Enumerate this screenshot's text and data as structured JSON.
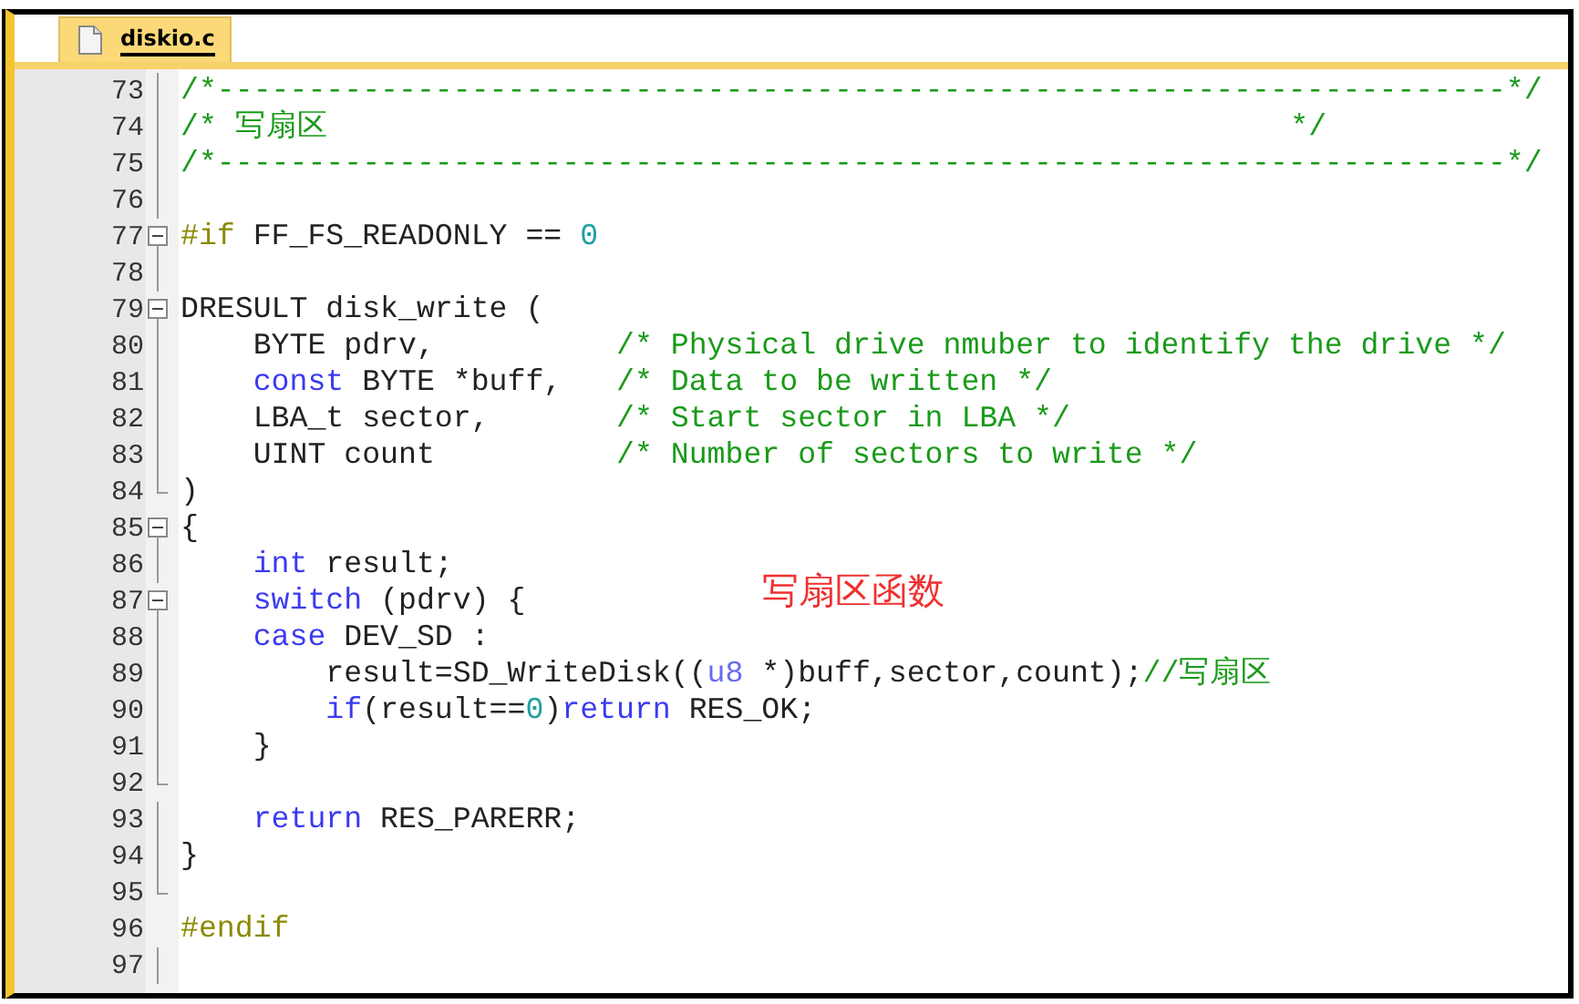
{
  "tabs": [
    {
      "label": "diskio.c",
      "selected": true
    }
  ],
  "lines": [
    {
      "number": "73",
      "kind": "body",
      "tokens": [
        {
          "text": "/*-----------------------------------------------------------------------*/",
          "kind": "comment"
        }
      ]
    },
    {
      "number": "74",
      "kind": "body",
      "tokens": [
        {
          "text": "/* 写扇区                                                     */",
          "kind": "comment"
        }
      ]
    },
    {
      "number": "75",
      "kind": "body",
      "tokens": [
        {
          "text": "/*-----------------------------------------------------------------------*/",
          "kind": "comment"
        }
      ]
    },
    {
      "number": "76",
      "kind": "body"
    },
    {
      "number": "77",
      "kind": "start",
      "tokens": [
        {
          "text": "#if",
          "kind": "pre"
        },
        {
          "text": " FF_FS_READONLY == ",
          "kind": "plain"
        },
        {
          "text": "0",
          "kind": "number"
        }
      ]
    },
    {
      "number": "78",
      "kind": "body"
    },
    {
      "number": "79",
      "kind": "start",
      "tokens": [
        {
          "text": "DRESULT disk_write (",
          "kind": "plain"
        }
      ],
      "children": [
        {
          "number": "80",
          "kind": "body",
          "tokens": [
            {
              "text": "BYTE pdrv,          ",
              "kind": "plain"
            },
            {
              "text": "/* Physical drive nmuber to identify the drive */",
              "kind": "comment"
            }
          ]
        },
        {
          "number": "81",
          "kind": "body",
          "tokens": [
            {
              "text": "const",
              "kind": "keyword"
            },
            {
              "text": " BYTE *buff,   ",
              "kind": "plain"
            },
            {
              "text": "/* Data to be written */",
              "kind": "comment"
            }
          ]
        },
        {
          "number": "82",
          "kind": "body",
          "tokens": [
            {
              "text": "LBA_t sector,       ",
              "kind": "plain"
            },
            {
              "text": "/* Start sector in LBA */",
              "kind": "comment"
            }
          ]
        },
        {
          "number": "83",
          "kind": "body",
          "tokens": [
            {
              "text": "UINT count          ",
              "kind": "plain"
            },
            {
              "text": "/* Number of sectors to write */",
              "kind": "comment"
            }
          ]
        }
      ]
    },
    {
      "number": "84",
      "kind": "end",
      "tokens": [
        {
          "text": ")",
          "kind": "plain"
        }
      ]
    },
    {
      "number": "85",
      "kind": "start",
      "tokens": [
        {
          "text": "{",
          "kind": "plain"
        }
      ],
      "children": [
        {
          "number": "86",
          "kind": "body",
          "tokens": [
            {
              "text": "int",
              "kind": "keyword"
            },
            {
              "text": " result;",
              "kind": "plain"
            }
          ]
        },
        {
          "number": "87",
          "kind": "start",
          "tokens": [
            {
              "text": "switch",
              "kind": "keyword"
            },
            {
              "text": " (pdrv) {",
              "kind": "plain"
            }
          ]
        },
        {
          "number": "88",
          "kind": "body",
          "tokens": [
            {
              "text": "case",
              "kind": "keyword"
            },
            {
              "text": " DEV_SD :",
              "kind": "plain"
            }
          ],
          "children": [
            {
              "number": "89",
              "kind": "body",
              "tokens": [
                {
                  "text": "result=SD_WriteDisk((",
                  "kind": "plain"
                },
                {
                  "text": "u8",
                  "kind": "type"
                },
                {
                  "text": " *)buff,sector,count);",
                  "kind": "plain"
                },
                {
                  "text": "//写扇区",
                  "kind": "comment"
                }
              ]
            },
            {
              "number": "90",
              "kind": "body",
              "tokens": [
                {
                  "text": "if",
                  "kind": "keyword"
                },
                {
                  "text": "(result==",
                  "kind": "plain"
                },
                {
                  "text": "0",
                  "kind": "number"
                },
                {
                  "text": ")",
                  "kind": "plain"
                },
                {
                  "text": "return",
                  "kind": "keyword"
                },
                {
                  "text": " RES_OK;",
                  "kind": "plain"
                }
              ]
            }
          ]
        },
        {
          "number": "91",
          "kind": "body",
          "tokens": [
            {
              "text": "}",
              "kind": "plain"
            }
          ]
        },
        {
          "number": "92",
          "kind": "end"
        },
        {
          "number": "93",
          "kind": "body",
          "tokens": [
            {
              "text": "return",
              "kind": "keyword"
            },
            {
              "text": " RES_PARERR;",
              "kind": "plain"
            }
          ]
        }
      ]
    },
    {
      "number": "94",
      "kind": "body",
      "tokens": [
        {
          "text": "}",
          "kind": "plain"
        }
      ]
    },
    {
      "number": "95",
      "kind": "end"
    },
    {
      "number": "96",
      "kind": "plain",
      "tokens": [
        {
          "text": "#endif",
          "kind": "pre"
        }
      ]
    },
    {
      "number": "97",
      "kind": "body"
    }
  ],
  "annotation": "写扇区函数"
}
